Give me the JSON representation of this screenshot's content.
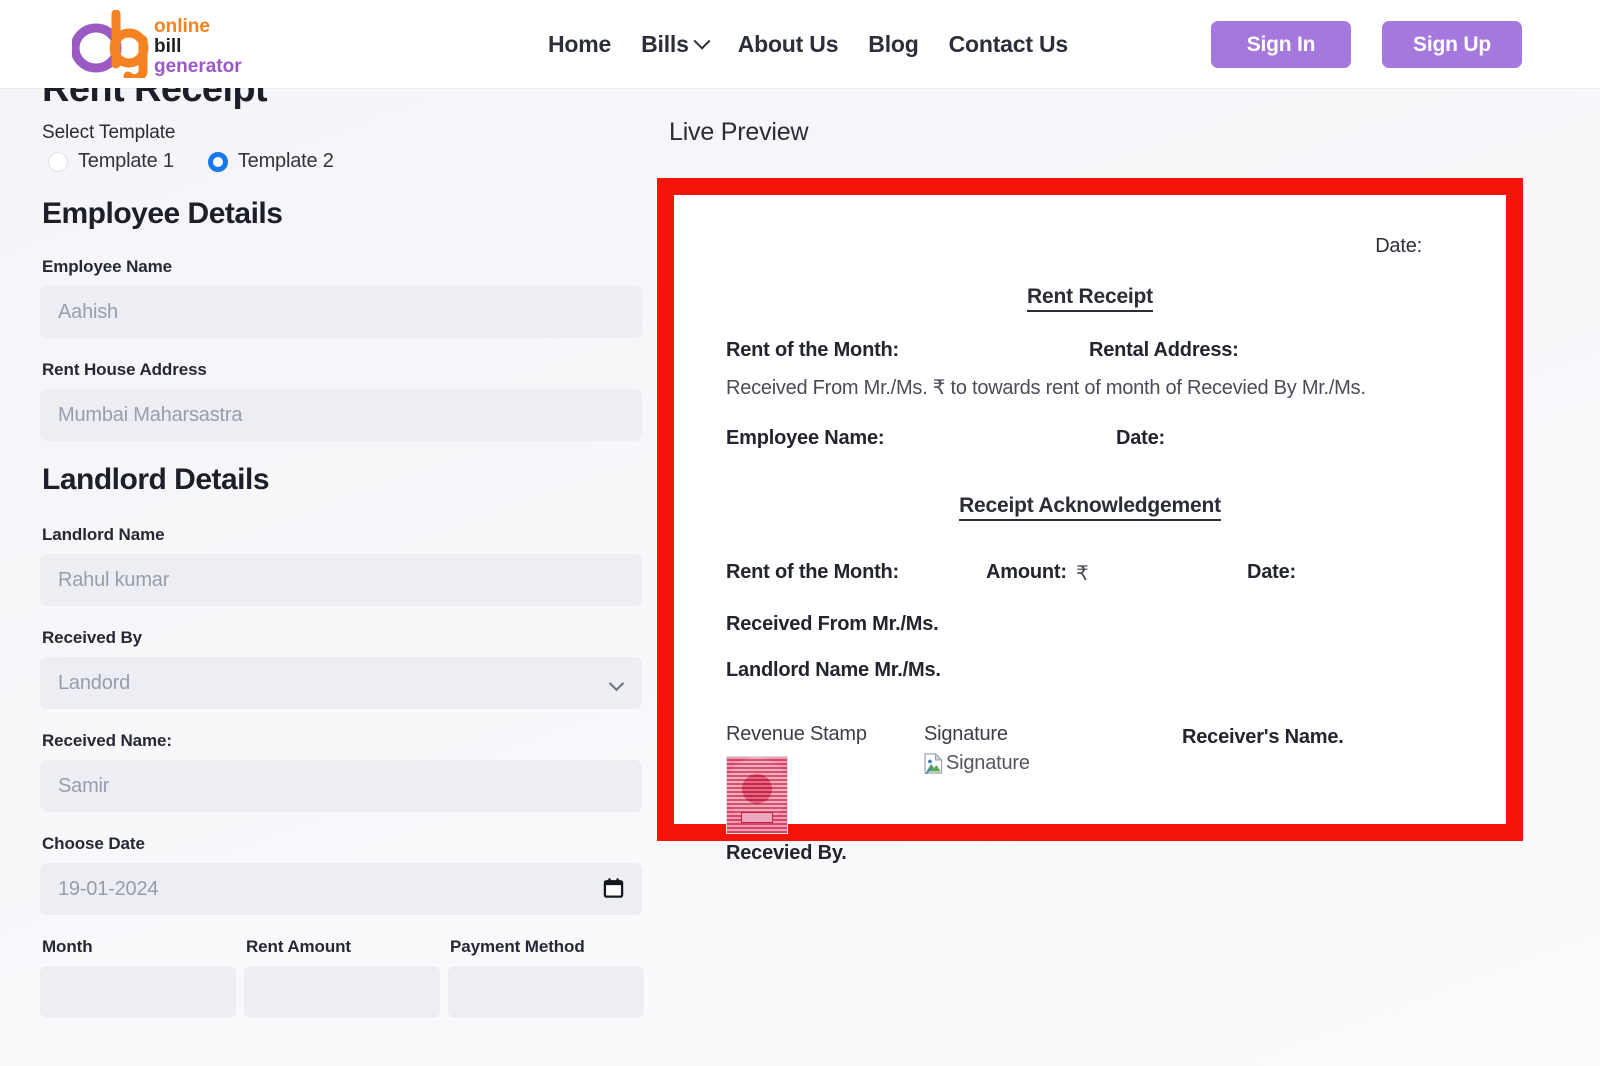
{
  "header": {
    "logo": {
      "word_top": "online",
      "word_mid": "bill",
      "word_bottom": "generator",
      "mark_letters": "obg",
      "purple": "#9b59c4",
      "orange": "#f48220"
    },
    "nav": [
      {
        "label": "Home",
        "has_caret": false
      },
      {
        "label": "Bills",
        "has_caret": true
      },
      {
        "label": "About Us",
        "has_caret": false
      },
      {
        "label": "Blog",
        "has_caret": false
      },
      {
        "label": "Contact Us",
        "has_caret": false
      }
    ],
    "sign_in": "Sign In",
    "sign_up": "Sign Up",
    "button_color": "#a478dd"
  },
  "form": {
    "page_title": "Rent Receipt",
    "select_template_label": "Select Template",
    "templates": [
      {
        "label": "Template 1",
        "selected": false
      },
      {
        "label": "Template 2",
        "selected": true
      }
    ],
    "radio_selected_color": "#1878f0",
    "employee_section_title": "Employee Details",
    "employee_name_label": "Employee Name",
    "employee_name_placeholder": "Aahish",
    "employee_name_value": "",
    "rent_house_address_label": "Rent House Address",
    "rent_house_address_placeholder": "Mumbai Maharsastra",
    "rent_house_address_value": "",
    "landlord_section_title": "Landlord Details",
    "landlord_name_label": "Landlord Name",
    "landlord_name_placeholder": "Rahul kumar",
    "landlord_name_value": "",
    "received_by_label": "Received By",
    "received_by_value": "Landord",
    "received_name_label": "Received Name:",
    "received_name_placeholder": "Samir",
    "received_name_value": "",
    "choose_date_label": "Choose Date",
    "choose_date_placeholder": "19-01-2024",
    "choose_date_value": "",
    "month_label": "Month",
    "rent_amount_label": "Rent Amount",
    "payment_method_label": "Payment Method"
  },
  "preview": {
    "title": "Live Preview",
    "highlight_border_color": "#f51409",
    "receipt": {
      "date_top": "Date:",
      "heading": "Rent Receipt",
      "rent_of_month_label": "Rent of the Month:",
      "rental_address_label": "Rental Address:",
      "sentence": "Received From Mr./Ms. ₹ to towards rent of month of Recevied By Mr./Ms.",
      "employee_name_label": "Employee Name:",
      "date_label": "Date:",
      "ack_heading": "Receipt Acknowledgement",
      "ack_rent_of_month_label": "Rent of the Month:",
      "ack_amount_label": "Amount:",
      "ack_amount_currency": "₹",
      "ack_date_label": "Date:",
      "received_from_label": "Received From Mr./Ms.",
      "landlord_name_label": "Landlord Name Mr./Ms.",
      "revenue_stamp_label": "Revenue Stamp",
      "signature_label": "Signature",
      "signature_broken_alt": "Signature",
      "receivers_name_label": "Receiver's Name.",
      "received_by_label": "Recevied By."
    }
  }
}
